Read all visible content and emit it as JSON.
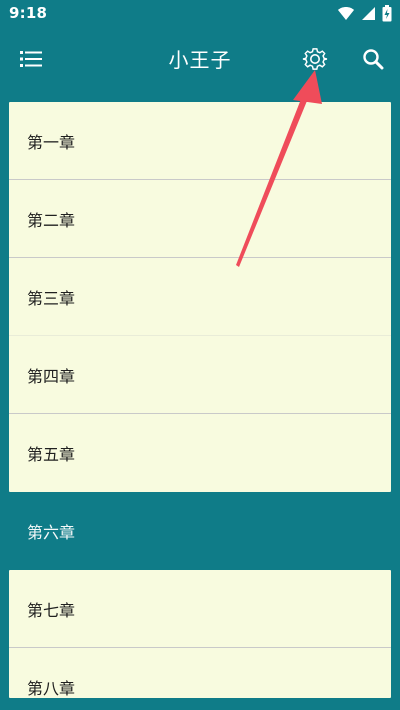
{
  "status_bar": {
    "time": "9:18"
  },
  "app_bar": {
    "title": "小王子",
    "menu_icon": "list-menu-icon",
    "settings_icon": "gear-icon",
    "search_icon": "search-icon"
  },
  "chapters": [
    "第一章",
    "第二章",
    "第三章",
    "第四章",
    "第五章",
    "第六章",
    "第七章",
    "第八章"
  ],
  "colors": {
    "app_bar": "#0f7c88",
    "card": "#f8fbdf",
    "annotation_arrow": "#ef4c5a"
  }
}
